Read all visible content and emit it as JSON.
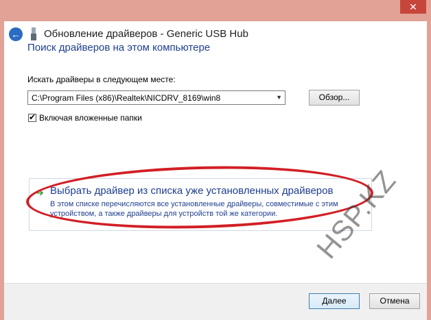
{
  "window": {
    "title": "Обновление драйверов - Generic USB Hub",
    "close_glyph": "✕",
    "back_glyph": "←"
  },
  "main": {
    "heading": "Поиск драйверов на этом компьютере",
    "location_label": "Искать драйверы в следующем месте:",
    "path_value": "C:\\Program Files (x86)\\Realtek\\NICDRV_8169\\win8",
    "browse_label": "Обзор...",
    "include_subfolders_label": "Включая вложенные папки",
    "include_subfolders_checked": "✔"
  },
  "option": {
    "title": "Выбрать драйвер из списка уже установленных драйверов",
    "desc_line1": "В этом списке перечисляются все установленные драйверы, совместимые с этим",
    "desc_line2": "устройством, а также драйверы для устройств той же категории."
  },
  "footer": {
    "next_label": "Далее",
    "cancel_label": "Отмена"
  },
  "watermark": "HSP.KZ"
}
